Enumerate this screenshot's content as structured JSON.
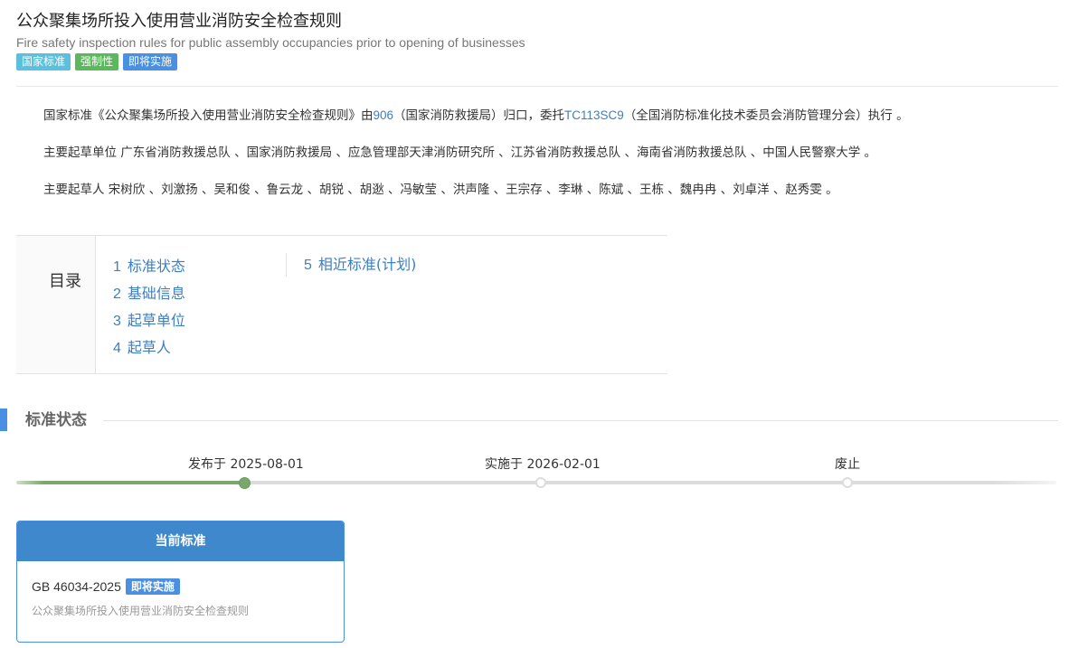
{
  "header": {
    "title": "公众聚集场所投入使用营业消防安全检查规则",
    "subtitle": "Fire safety inspection rules for public assembly occupancies prior to opening of businesses",
    "badges": [
      "国家标准",
      "强制性",
      "即将实施"
    ]
  },
  "intro": {
    "line1_prefix": "国家标准《公众聚集场所投入使用营业消防安全检查规则》由",
    "line1_org_code": "906",
    "line1_mid": "（国家消防救援局）归口，委托",
    "line1_tc_code": "TC113SC9",
    "line1_suffix": "（全国消防标准化技术委员会消防管理分会）执行 。",
    "line2": "主要起草单位 广东省消防救援总队 、国家消防救援局 、应急管理部天津消防研究所 、江苏省消防救援总队 、海南省消防救援总队 、中国人民警察大学 。",
    "line3": "主要起草人 宋树欣 、刘激扬 、吴和俊 、鲁云龙 、胡锐 、胡逖 、冯敏莹 、洪声隆 、王宗存 、李琳 、陈斌 、王栋 、魏冉冉 、刘卓洋 、赵秀雯 。"
  },
  "toc": {
    "label": "目录",
    "items": [
      {
        "num": "1",
        "label": "标准状态"
      },
      {
        "num": "2",
        "label": "基础信息"
      },
      {
        "num": "3",
        "label": "起草单位"
      },
      {
        "num": "4",
        "label": "起草人"
      },
      {
        "num": "5",
        "label": "相近标准(计划)"
      }
    ]
  },
  "status_section": {
    "title": "标准状态",
    "timeline": [
      {
        "label": "发布于 2025-08-01",
        "state": "done"
      },
      {
        "label": "实施于 2026-02-01",
        "state": "pending"
      },
      {
        "label": "废止",
        "state": "pending"
      }
    ]
  },
  "current_card": {
    "heading": "当前标准",
    "code": "GB 46034-2025",
    "badge": "即将实施",
    "name": "公众聚集场所投入使用营业消防安全检查规则"
  },
  "colors": {
    "accent_blue": "#4a90e2",
    "badge_cyan": "#5bc0de",
    "badge_green": "#5cb85c",
    "timeline_green": "#7aa86a",
    "link_blue": "#3d7fc1"
  }
}
